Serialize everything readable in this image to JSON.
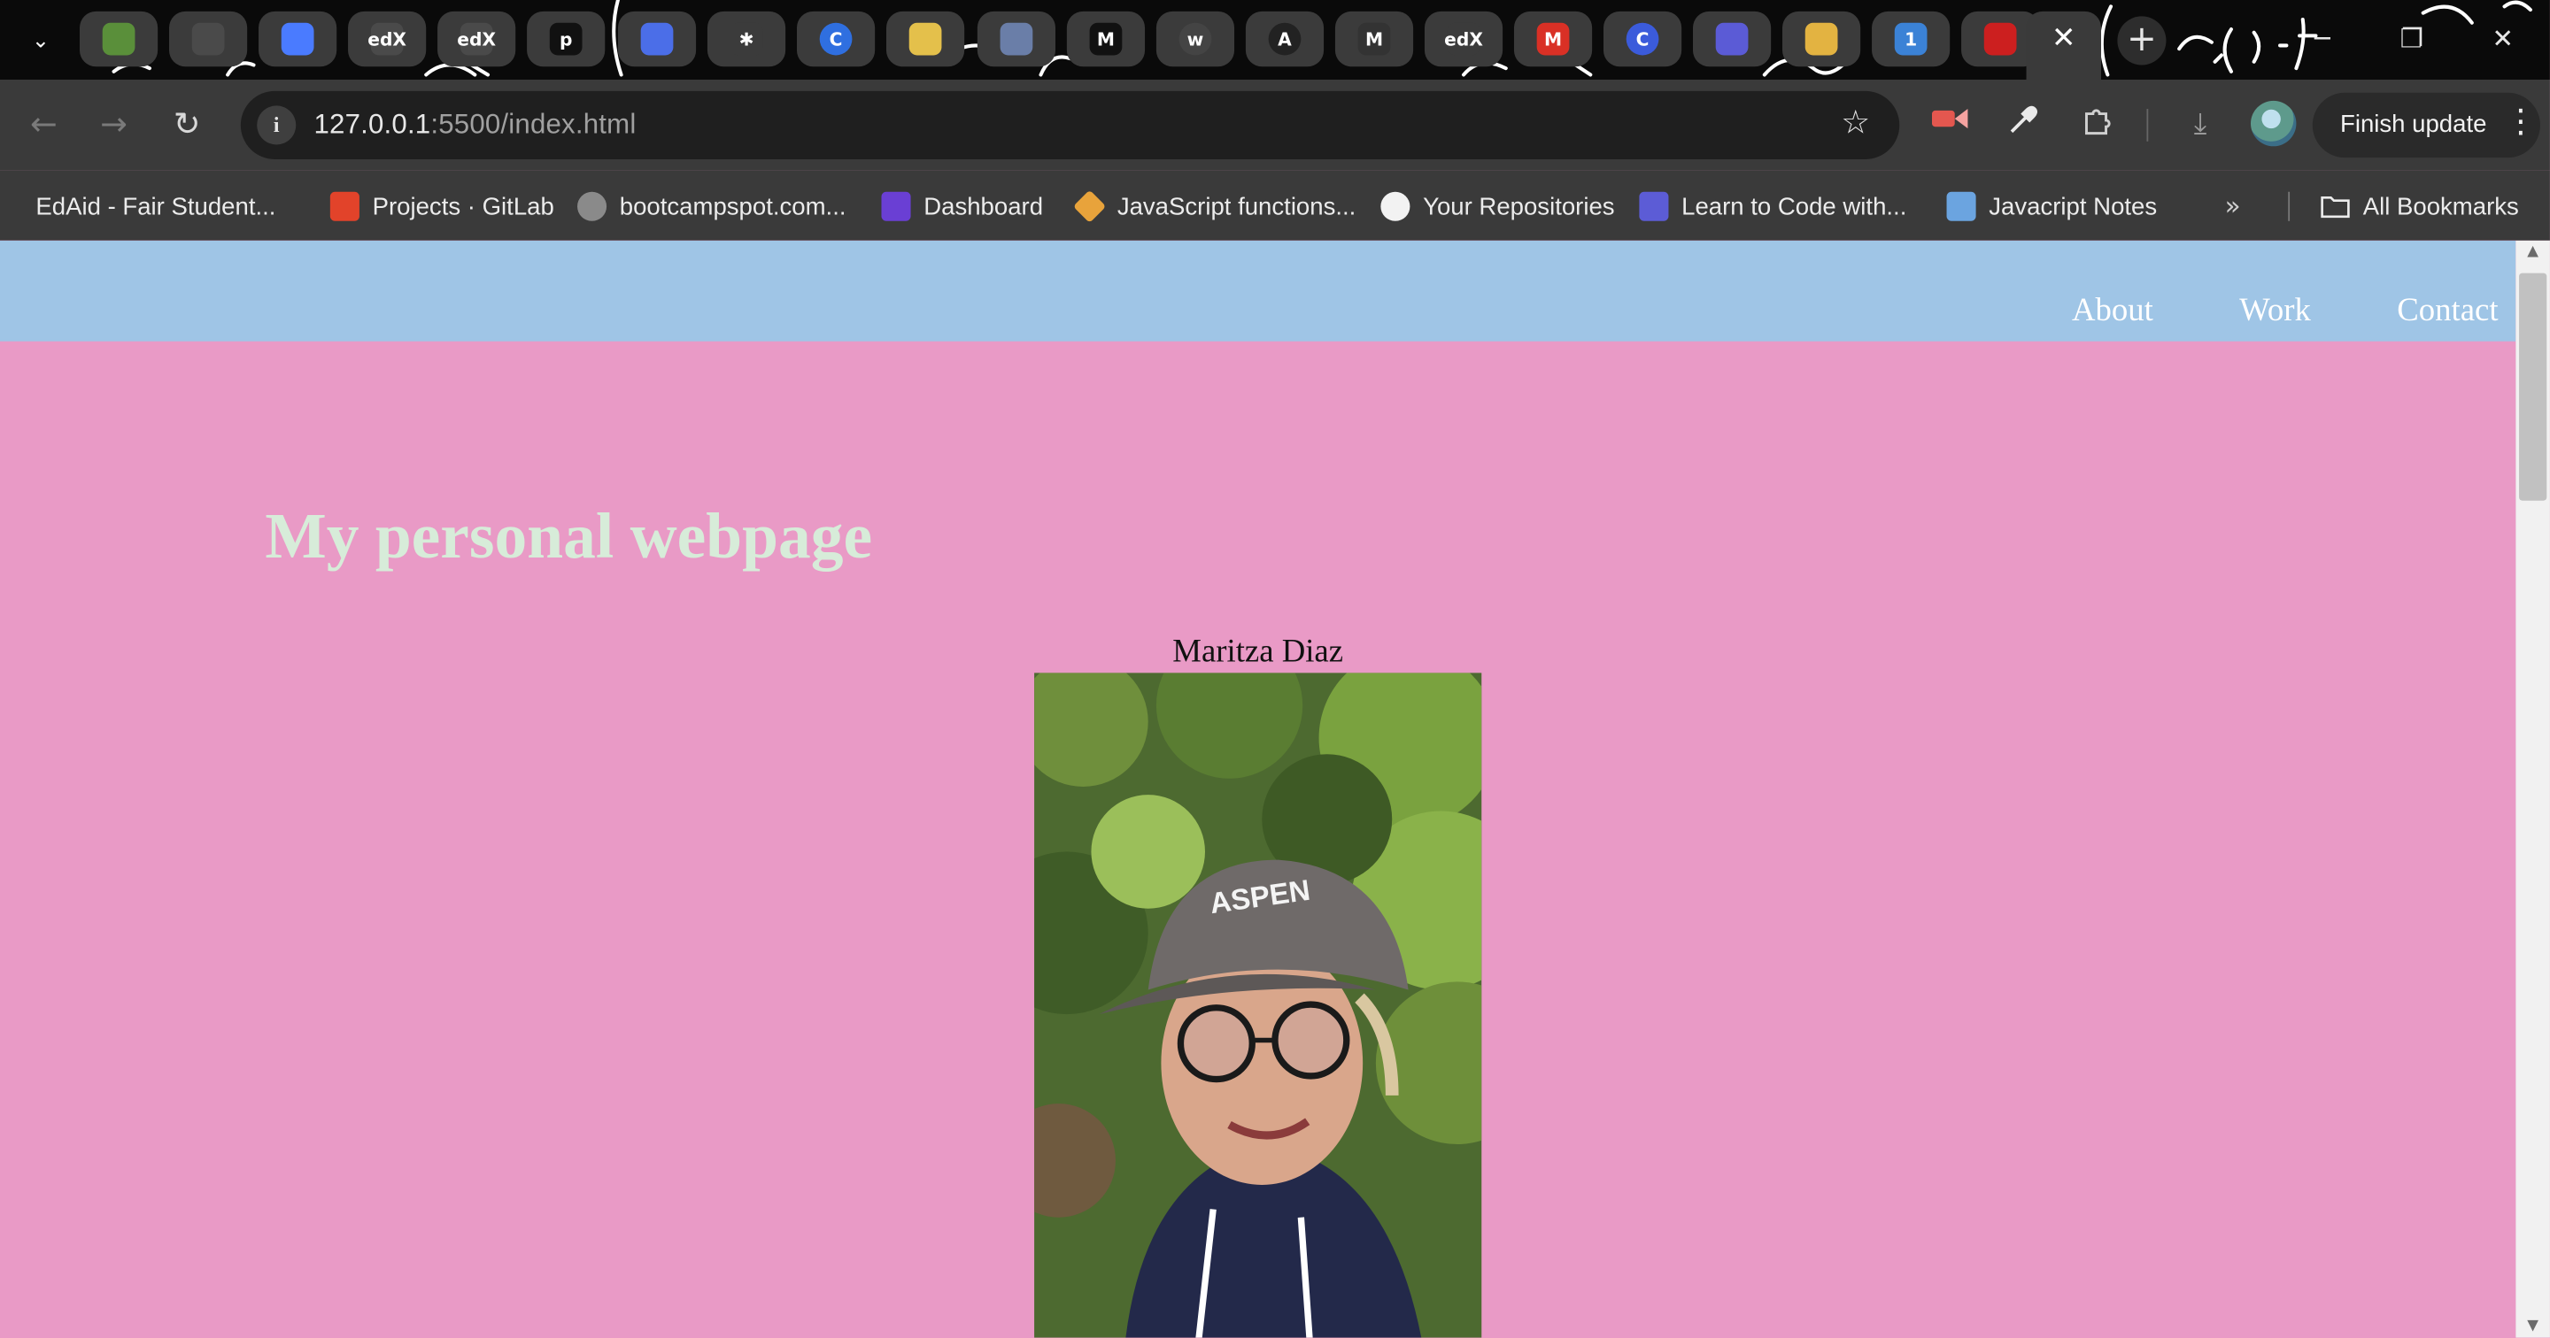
{
  "browser": {
    "pinned_tabs": [
      {
        "icon": "plant-icon",
        "glyph": "",
        "color": "#5a8f3a"
      },
      {
        "icon": "trello-icon",
        "glyph": "",
        "color": "#4a4a4a"
      },
      {
        "icon": "docs-icon",
        "glyph": "",
        "color": "#4a7bff"
      },
      {
        "icon": "edx-icon",
        "glyph": "edX",
        "color": "#4a4a4a"
      },
      {
        "icon": "edx-icon",
        "glyph": "edX",
        "color": "#4a4a4a"
      },
      {
        "icon": "p-icon",
        "glyph": "p",
        "color": "#111111"
      },
      {
        "icon": "flag-icon",
        "glyph": "",
        "color": "#4b6ee8"
      },
      {
        "icon": "asterisk-icon",
        "glyph": "✱",
        "color": "#3b3b3b"
      },
      {
        "icon": "circle-c-icon",
        "glyph": "C",
        "color": "#2f6fe0"
      },
      {
        "icon": "notebook-icon",
        "glyph": "",
        "color": "#e4c04b"
      },
      {
        "icon": "window-icon",
        "glyph": "",
        "color": "#6a7ea8"
      },
      {
        "icon": "m-icon",
        "glyph": "M",
        "color": "#111111"
      },
      {
        "icon": "w-icon",
        "glyph": "w",
        "color": "#444444"
      },
      {
        "icon": "a-icon",
        "glyph": "A",
        "color": "#222222"
      },
      {
        "icon": "m-circle-icon",
        "glyph": "M",
        "color": "#333333"
      },
      {
        "icon": "edx-icon",
        "glyph": "edX",
        "color": "#3b3b3b"
      },
      {
        "icon": "gmail-icon",
        "glyph": "M",
        "color": "#d93025"
      },
      {
        "icon": "c-icon",
        "glyph": "C",
        "color": "#3b5bdb"
      },
      {
        "icon": "screen-icon",
        "glyph": "",
        "color": "#5b5bd6"
      },
      {
        "icon": "coin-icon",
        "glyph": "",
        "color": "#e3b341"
      },
      {
        "icon": "one-icon",
        "glyph": "1",
        "color": "#3b82d6"
      },
      {
        "icon": "redhat-icon",
        "glyph": "",
        "color": "#cc1f1f"
      }
    ],
    "active_tab_close": "✕",
    "new_tab": "+",
    "url_host": "127.0.0.1",
    "url_rest": ":5500/index.html",
    "update_label": "Finish update",
    "bookmarks": [
      {
        "label": "EdAid - Fair Student...",
        "icon": "",
        "color": "none"
      },
      {
        "label": "Projects · GitLab",
        "icon": "gitlab-icon",
        "color": "#e2432a"
      },
      {
        "label": "bootcampspot.com...",
        "icon": "globe-icon",
        "color": "#8a8a8a"
      },
      {
        "label": "Dashboard",
        "icon": "slash-icon",
        "color": "#6a3fd4"
      },
      {
        "label": "JavaScript functions...",
        "icon": "diamond-icon",
        "color": "#e8a33b"
      },
      {
        "label": "Your Repositories",
        "icon": "github-icon",
        "color": "#f2f2f2"
      },
      {
        "label": "Learn to Code with...",
        "icon": "bot-icon",
        "color": "#5c5cd6"
      },
      {
        "label": "Javacript Notes",
        "icon": "monitor-icon",
        "color": "#6ba4e0"
      }
    ],
    "all_bookmarks": "All Bookmarks",
    "overflow": "»"
  },
  "page": {
    "nav": [
      "About",
      "Work",
      "Contact"
    ],
    "title": "My personal webpage",
    "name": "Maritza Diaz",
    "photo_text": "ASPEN",
    "colors": {
      "header": "#9fc5e6",
      "background": "#e99ac6",
      "title": "#d7ecd9"
    }
  }
}
